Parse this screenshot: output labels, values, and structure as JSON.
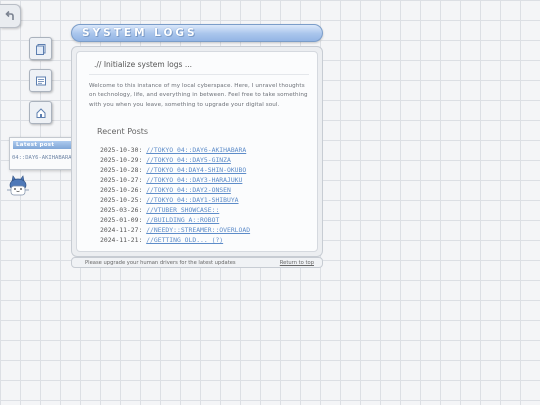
{
  "window": {
    "title": "SYSTEM LOGS",
    "heading": ".// Initialize system logs ...",
    "intro": "Welcome to this instance of my local cyberspace. Here, I unravel thoughts on technology, life, and everything in between. Feel free to take something with you when you leave, something to upgrade your digital soul.",
    "recent_title": "Recent Posts",
    "posts": [
      {
        "date": "2025-10-30:",
        "title": "//TOKYO_04::DAY6-AKIHABARA"
      },
      {
        "date": "2025-10-29:",
        "title": "//TOKYO_04::DAY5-GINZA"
      },
      {
        "date": "2025-10-28:",
        "title": "//TOKYO_04:DAY4-SHIN-OKUBO"
      },
      {
        "date": "2025-10-27:",
        "title": "//TOKYO_04::DAY3-HARAJUKU"
      },
      {
        "date": "2025-10-26:",
        "title": "//TOKYO_04::DAY2-ONSEN"
      },
      {
        "date": "2025-10-25:",
        "title": "//TOKYO_04::DAY1-SHIBUYA"
      },
      {
        "date": "2025-03-26:",
        "title": "//VTUBER_SHOWCASE::"
      },
      {
        "date": "2025-01-09:",
        "title": "//BUILDING_A::ROBOT"
      },
      {
        "date": "2024-11-27:",
        "title": "//NEEDY::STREAMER::OVERLOAD"
      },
      {
        "date": "2024-11-21:",
        "title": "//GETTING_OLD... (?)"
      }
    ]
  },
  "footer": {
    "left": "Please upgrade your human drivers for the latest updates",
    "right": "Return to top"
  },
  "latest": {
    "label": "Latest post",
    "item": "04::DAY6-AKIHABARA"
  },
  "icons": [
    "back-arrow-icon",
    "document-icon",
    "window-icon",
    "home-icon",
    "mascot-icon"
  ],
  "colors": {
    "accent": "#93b5e4",
    "link": "#5d8cc9"
  }
}
